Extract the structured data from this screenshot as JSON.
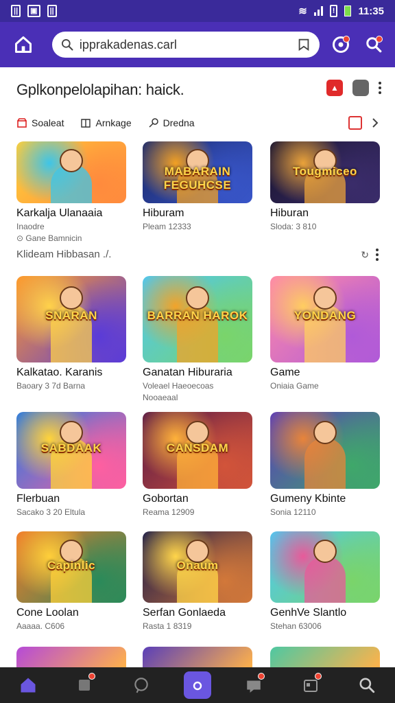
{
  "status_bar": {
    "left_icons": [
      "sim-icon",
      "image-icon",
      "sim-icon"
    ],
    "time": "11:35"
  },
  "header": {
    "search_text": "ipprakadenas.carl"
  },
  "section": {
    "title": "Gplkonpelolapihan: haick."
  },
  "chips": [
    {
      "label": "Soaleat",
      "icon": "shop-icon"
    },
    {
      "label": "Arnkage",
      "icon": "book-icon"
    },
    {
      "label": "Dredna",
      "icon": "pin-icon"
    }
  ],
  "subrow": {
    "label": "Klideam Hibbasan ./."
  },
  "cards": [
    {
      "name": "Karkalja Ulanaaia",
      "meta": "Inaodre",
      "meta2": "⊙ Gane Bamnicin",
      "art_text": "",
      "colors": [
        "#ffcf3a",
        "#ff8a3d",
        "#3ec5e8"
      ]
    },
    {
      "name": "Hiburam",
      "meta": "Pleam 12333",
      "meta2": "",
      "art_text": "MABARAIN FEGUHCSE",
      "colors": [
        "#1b2a6b",
        "#3855c8",
        "#f2a023"
      ]
    },
    {
      "name": "Hiburan",
      "meta": "Sloda: 3 810",
      "meta2": "",
      "art_text": "Tougmiceo",
      "colors": [
        "#1a1530",
        "#3a2c6a",
        "#e9a23a"
      ]
    },
    {
      "name": "Kalkatao. Karanis",
      "meta": "Baoary 3 7d Barna",
      "meta2": "",
      "art_text": "SNARAN",
      "colors": [
        "#ff9a2a",
        "#5a3bd8",
        "#ffd24a"
      ]
    },
    {
      "name": "Ganatan Hiburaria",
      "meta": "Voleael Haeoecoas",
      "meta2": "Nooaeaal",
      "art_text": "BARRAN HAROK",
      "colors": [
        "#4ec7f2",
        "#7ad46a",
        "#f2a32a"
      ]
    },
    {
      "name": "Game",
      "meta": "Oniaia Game",
      "meta2": "",
      "art_text": "YONDANG",
      "colors": [
        "#ff8aa8",
        "#b05ad8",
        "#ffcd60"
      ]
    },
    {
      "name": "Flerbuan",
      "meta": "Sacako 3 20 Eltula",
      "meta2": "",
      "art_text": "SABDAAK",
      "colors": [
        "#2a7ae0",
        "#ff5fa0",
        "#ffd43a"
      ]
    },
    {
      "name": "Gobortan",
      "meta": "Reama 12909",
      "meta2": "",
      "art_text": "CANSDAM",
      "colors": [
        "#5a1a48",
        "#d2543a",
        "#ffb23a"
      ]
    },
    {
      "name": "Gumeny Kbinte",
      "meta": "Sonia 12110",
      "meta2": "",
      "art_text": "",
      "colors": [
        "#5a3fb8",
        "#3fa86a",
        "#e8843a"
      ]
    },
    {
      "name": "Cone Loolan",
      "meta": "Aaaaa. C606",
      "meta2": "",
      "art_text": "Capinlic",
      "colors": [
        "#f27a2a",
        "#2a8a5a",
        "#ffcf3a"
      ]
    },
    {
      "name": "Serfan Gonlaeda",
      "meta": "Rasta 1 8319",
      "meta2": "",
      "art_text": "Onaum",
      "colors": [
        "#1a1a4a",
        "#d2783a",
        "#ffd54a"
      ]
    },
    {
      "name": "GenhVe Slantlo",
      "meta": "Stehan 63006",
      "meta2": "",
      "art_text": "",
      "colors": [
        "#4ec8f2",
        "#7ad46a",
        "#e85a9a"
      ]
    }
  ],
  "bottom_nav": [
    {
      "icon": "home-icon",
      "badge": false
    },
    {
      "icon": "inbox-icon",
      "badge": true
    },
    {
      "icon": "chat-icon",
      "badge": false
    },
    {
      "icon": "camera-icon",
      "badge": false
    },
    {
      "icon": "messages-icon",
      "badge": true
    },
    {
      "icon": "calendar-icon",
      "badge": true
    },
    {
      "icon": "search-icon",
      "badge": false
    }
  ],
  "theme": {
    "primary": "#4a2fb6",
    "status": "#3a2a9a",
    "nav_bg": "#222222",
    "accent_red": "#e02a2a"
  }
}
